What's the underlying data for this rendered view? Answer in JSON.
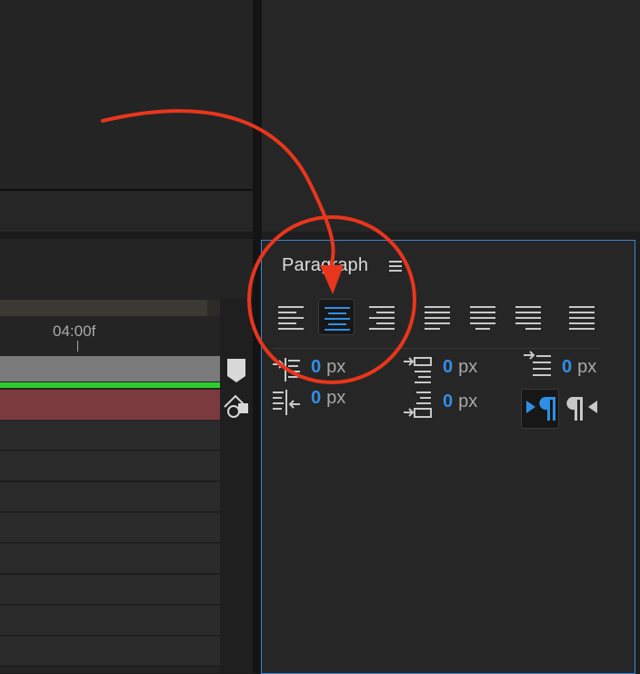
{
  "timeline": {
    "ruler_label": "04:00f"
  },
  "paragraph_panel": {
    "title": "Paragraph",
    "alignment_buttons": [
      {
        "name": "align-left",
        "active": false
      },
      {
        "name": "align-center",
        "active": true
      },
      {
        "name": "align-right",
        "active": false
      },
      {
        "name": "justify-last-left",
        "active": false
      },
      {
        "name": "justify-last-center",
        "active": false
      },
      {
        "name": "justify-last-right",
        "active": false
      },
      {
        "name": "justify-all",
        "active": false
      }
    ],
    "indent_left": {
      "value": "0",
      "unit": "px"
    },
    "indent_right": {
      "value": "0",
      "unit": "px"
    },
    "space_before": {
      "value": "0",
      "unit": "px"
    },
    "space_after": {
      "value": "0",
      "unit": "px"
    },
    "first_line_indent": {
      "value": "0",
      "unit": "px"
    },
    "text_direction": "left-to-right"
  },
  "colors": {
    "accent_blue": "#2f8fe6",
    "panel_border": "#3b86d6",
    "annotation_red": "#e8361c"
  }
}
